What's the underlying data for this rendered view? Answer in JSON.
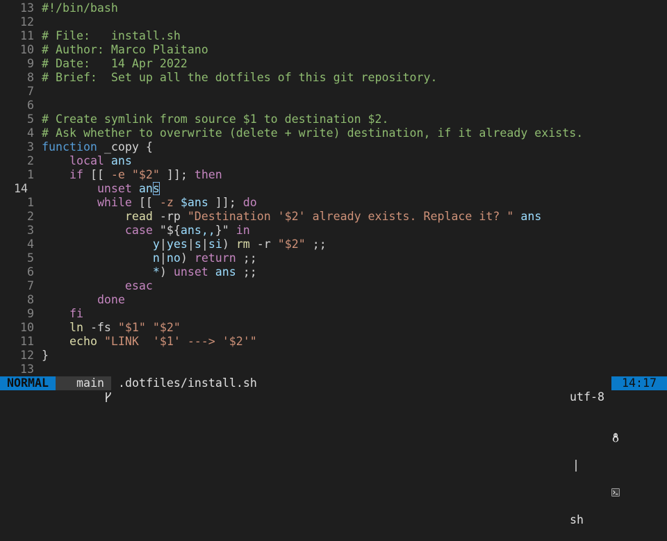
{
  "editor": {
    "lines": [
      {
        "num": "13",
        "tokens": [
          {
            "t": "#!/bin/bash",
            "c": "comment"
          }
        ]
      },
      {
        "num": "12",
        "tokens": []
      },
      {
        "num": "11",
        "tokens": [
          {
            "t": "# File:   install.sh",
            "c": "comment"
          }
        ]
      },
      {
        "num": "10",
        "tokens": [
          {
            "t": "# Author: Marco Plaitano",
            "c": "comment"
          }
        ]
      },
      {
        "num": "9",
        "tokens": [
          {
            "t": "# Date:   14 Apr 2022",
            "c": "comment"
          }
        ]
      },
      {
        "num": "8",
        "tokens": [
          {
            "t": "# Brief:  Set up all the dotfiles of this git repository.",
            "c": "comment"
          }
        ]
      },
      {
        "num": "7",
        "tokens": []
      },
      {
        "num": "6",
        "tokens": []
      },
      {
        "num": "5",
        "tokens": [
          {
            "t": "# Create symlink from source $1 to destination $2.",
            "c": "comment"
          }
        ]
      },
      {
        "num": "4",
        "tokens": [
          {
            "t": "# Ask whether to overwrite (delete + write) destination, if it already exists.",
            "c": "comment"
          }
        ]
      },
      {
        "num": "3",
        "tokens": [
          {
            "t": "function",
            "c": "decl"
          },
          {
            "t": " _copy {",
            "c": "plain"
          }
        ]
      },
      {
        "num": "2",
        "tokens": [
          {
            "t": "    ",
            "c": "plain"
          },
          {
            "t": "local",
            "c": "keyword"
          },
          {
            "t": " ",
            "c": "plain"
          },
          {
            "t": "ans",
            "c": "var"
          }
        ]
      },
      {
        "num": "1",
        "tokens": [
          {
            "t": "    ",
            "c": "plain"
          },
          {
            "t": "if",
            "c": "keyword"
          },
          {
            "t": " [[ ",
            "c": "plain"
          },
          {
            "t": "-e",
            "c": "string"
          },
          {
            "t": " ",
            "c": "plain"
          },
          {
            "t": "\"$2\"",
            "c": "string"
          },
          {
            "t": " ]]; ",
            "c": "plain"
          },
          {
            "t": "then",
            "c": "keyword"
          }
        ]
      },
      {
        "num": "14",
        "current": true,
        "tokens": [
          {
            "t": "        ",
            "c": "plain"
          },
          {
            "t": "unset",
            "c": "keyword"
          },
          {
            "t": " ",
            "c": "plain"
          },
          {
            "t": "an",
            "c": "var"
          },
          {
            "t": "s",
            "c": "var",
            "cursor": true
          }
        ]
      },
      {
        "num": "1",
        "tokens": [
          {
            "t": "        ",
            "c": "plain"
          },
          {
            "t": "while",
            "c": "keyword"
          },
          {
            "t": " [[ ",
            "c": "plain"
          },
          {
            "t": "-z",
            "c": "string"
          },
          {
            "t": " ",
            "c": "plain"
          },
          {
            "t": "$ans",
            "c": "var"
          },
          {
            "t": " ]]; ",
            "c": "plain"
          },
          {
            "t": "do",
            "c": "keyword"
          }
        ]
      },
      {
        "num": "2",
        "tokens": [
          {
            "t": "            ",
            "c": "plain"
          },
          {
            "t": "read",
            "c": "func"
          },
          {
            "t": " -rp ",
            "c": "plain"
          },
          {
            "t": "\"Destination '$2' already exists. Replace it? \"",
            "c": "string"
          },
          {
            "t": " ",
            "c": "plain"
          },
          {
            "t": "ans",
            "c": "var"
          }
        ]
      },
      {
        "num": "3",
        "tokens": [
          {
            "t": "            ",
            "c": "plain"
          },
          {
            "t": "case",
            "c": "keyword"
          },
          {
            "t": " ",
            "c": "plain"
          },
          {
            "t": "\"${",
            "c": "plain"
          },
          {
            "t": "ans,,",
            "c": "var"
          },
          {
            "t": "}\"",
            "c": "plain"
          },
          {
            "t": " ",
            "c": "plain"
          },
          {
            "t": "in",
            "c": "keyword"
          }
        ]
      },
      {
        "num": "4",
        "tokens": [
          {
            "t": "                ",
            "c": "plain"
          },
          {
            "t": "y",
            "c": "var"
          },
          {
            "t": "|",
            "c": "plain"
          },
          {
            "t": "yes",
            "c": "var"
          },
          {
            "t": "|",
            "c": "plain"
          },
          {
            "t": "s",
            "c": "var"
          },
          {
            "t": "|",
            "c": "plain"
          },
          {
            "t": "si",
            "c": "var"
          },
          {
            "t": ") ",
            "c": "plain"
          },
          {
            "t": "rm",
            "c": "func"
          },
          {
            "t": " -r ",
            "c": "plain"
          },
          {
            "t": "\"$2\"",
            "c": "string"
          },
          {
            "t": " ;;",
            "c": "plain"
          }
        ]
      },
      {
        "num": "5",
        "tokens": [
          {
            "t": "                ",
            "c": "plain"
          },
          {
            "t": "n",
            "c": "var"
          },
          {
            "t": "|",
            "c": "plain"
          },
          {
            "t": "no",
            "c": "var"
          },
          {
            "t": ") ",
            "c": "plain"
          },
          {
            "t": "return",
            "c": "keyword"
          },
          {
            "t": " ;;",
            "c": "plain"
          }
        ]
      },
      {
        "num": "6",
        "tokens": [
          {
            "t": "                ",
            "c": "plain"
          },
          {
            "t": "*",
            "c": "var"
          },
          {
            "t": ") ",
            "c": "plain"
          },
          {
            "t": "unset",
            "c": "keyword"
          },
          {
            "t": " ",
            "c": "plain"
          },
          {
            "t": "ans",
            "c": "var"
          },
          {
            "t": " ;;",
            "c": "plain"
          }
        ]
      },
      {
        "num": "7",
        "tokens": [
          {
            "t": "            ",
            "c": "plain"
          },
          {
            "t": "esac",
            "c": "keyword"
          }
        ]
      },
      {
        "num": "8",
        "tokens": [
          {
            "t": "        ",
            "c": "plain"
          },
          {
            "t": "done",
            "c": "keyword"
          }
        ]
      },
      {
        "num": "9",
        "tokens": [
          {
            "t": "    ",
            "c": "plain"
          },
          {
            "t": "fi",
            "c": "keyword"
          }
        ]
      },
      {
        "num": "10",
        "tokens": [
          {
            "t": "    ",
            "c": "plain"
          },
          {
            "t": "ln",
            "c": "func"
          },
          {
            "t": " -fs ",
            "c": "plain"
          },
          {
            "t": "\"$1\"",
            "c": "string"
          },
          {
            "t": " ",
            "c": "plain"
          },
          {
            "t": "\"$2\"",
            "c": "string"
          }
        ]
      },
      {
        "num": "11",
        "tokens": [
          {
            "t": "    ",
            "c": "plain"
          },
          {
            "t": "echo",
            "c": "func"
          },
          {
            "t": " ",
            "c": "plain"
          },
          {
            "t": "\"LINK  '$1' ---> '$2'\"",
            "c": "string"
          }
        ]
      },
      {
        "num": "12",
        "tokens": [
          {
            "t": "}",
            "c": "plain"
          }
        ]
      },
      {
        "num": "13",
        "tokens": []
      }
    ]
  },
  "statusline": {
    "mode": "NORMAL",
    "branch_icon": "git-branch-icon",
    "branch": "main",
    "file": ".dotfiles/install.sh",
    "encoding": "utf-8",
    "sep1": "|",
    "os_icon": "linux-tux-icon",
    "sep2": "|",
    "filetype_icon": "terminal-icon",
    "filetype": "sh",
    "time": "14:17"
  },
  "colors": {
    "background": "#1e1e1e",
    "line_number": "#858585",
    "comment": "#8fbc70",
    "keyword": "#c586c0",
    "string": "#ce9178",
    "variable": "#9cdcfe",
    "function": "#dcdcaa",
    "declaration": "#569cd6",
    "mode_bg": "#0a7ac9",
    "branch_bg": "#3a3a3a"
  }
}
